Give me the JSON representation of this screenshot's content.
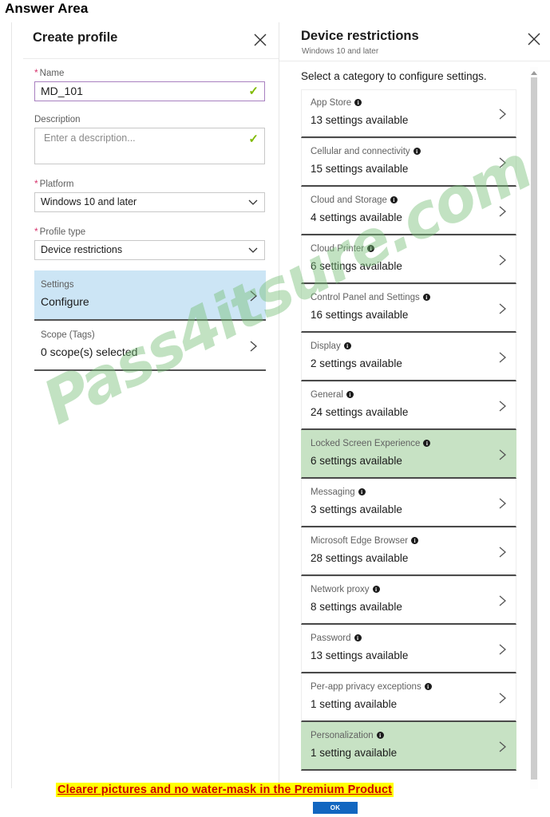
{
  "page": {
    "title": "Answer Area"
  },
  "create_profile": {
    "title": "Create profile",
    "close_icon": "close-icon",
    "name": {
      "label": "Name",
      "value": "MD_101",
      "placeholder": "",
      "valid_icon": "check-icon"
    },
    "description": {
      "label": "Description",
      "value": "",
      "placeholder": "Enter a description...",
      "valid_icon": "check-icon"
    },
    "platform": {
      "label": "Platform",
      "value": "Windows 10 and later",
      "caret_icon": "chevron-down-icon"
    },
    "profile_type": {
      "label": "Profile type",
      "value": "Device restrictions",
      "caret_icon": "chevron-down-icon"
    },
    "settings_row": {
      "label": "Settings",
      "value": "Configure",
      "chevron_icon": "chevron-right-icon",
      "selected": true
    },
    "scope_row": {
      "label": "Scope (Tags)",
      "value": "0 scope(s) selected",
      "chevron_icon": "chevron-right-icon",
      "selected": false
    },
    "required_marker": "*"
  },
  "device_restrictions": {
    "title": "Device restrictions",
    "subtitle": "Windows 10 and later",
    "close_icon": "close-icon",
    "instruction": "Select a category to configure settings.",
    "info_glyph": "i",
    "chevron_icon": "chevron-right-icon",
    "scrollbar": {
      "up_arrow_icon": "caret-up-icon"
    },
    "categories": [
      {
        "name": "App Store",
        "count": "13 settings available",
        "highlight": false
      },
      {
        "name": "Cellular and connectivity",
        "count": "15 settings available",
        "highlight": false
      },
      {
        "name": "Cloud and Storage",
        "count": "4 settings available",
        "highlight": false
      },
      {
        "name": "Cloud Printer",
        "count": "6 settings available",
        "highlight": false
      },
      {
        "name": "Control Panel and Settings",
        "count": "16 settings available",
        "highlight": false
      },
      {
        "name": "Display",
        "count": "2 settings available",
        "highlight": false
      },
      {
        "name": "General",
        "count": "24 settings available",
        "highlight": false
      },
      {
        "name": "Locked Screen Experience",
        "count": "6 settings available",
        "highlight": true
      },
      {
        "name": "Messaging",
        "count": "3 settings available",
        "highlight": false
      },
      {
        "name": "Microsoft Edge Browser",
        "count": "28 settings available",
        "highlight": false
      },
      {
        "name": "Network proxy",
        "count": "8 settings available",
        "highlight": false
      },
      {
        "name": "Password",
        "count": "13 settings available",
        "highlight": false
      },
      {
        "name": "Per-app privacy exceptions",
        "count": "1 setting available",
        "highlight": false
      },
      {
        "name": "Personalization",
        "count": "1 setting available",
        "highlight": true
      }
    ]
  },
  "watermark": {
    "text": "Pass4itsure.com"
  },
  "footer": {
    "banner": "Clearer pictures and no water-mask in the Premium Product",
    "ok_label": "OK"
  },
  "colors": {
    "selected_row": "#cce5f5",
    "highlight_row": "#c7e2c4",
    "required_star": "#d6336c",
    "valid_check": "#7fba00",
    "focus_border": "#a880c0",
    "banner_text": "#cc0000",
    "banner_background": "#ffff00",
    "ok_button": "#1266c0",
    "watermark": "#78be78"
  }
}
